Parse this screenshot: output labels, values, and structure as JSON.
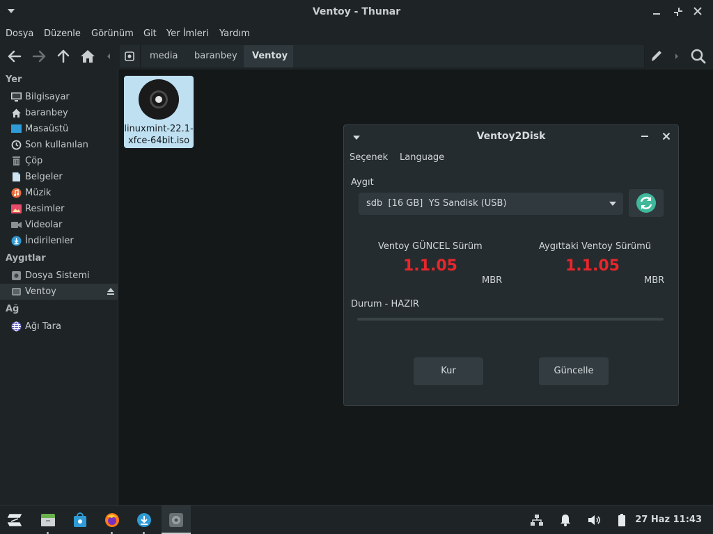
{
  "window": {
    "title": "Ventoy - Thunar"
  },
  "menubar": {
    "items": [
      "Dosya",
      "Düzenle",
      "Görünüm",
      "Git",
      "Yer İmleri",
      "Yardım"
    ]
  },
  "breadcrumb": {
    "items": [
      "media",
      "baranbey",
      "Ventoy"
    ]
  },
  "sidebar": {
    "sections": [
      "Yer",
      "Aygıtlar",
      "Ağ"
    ],
    "places": [
      "Bilgisayar",
      "baranbey",
      "Masaüstü",
      "Son kullanılan",
      "Çöp",
      "Belgeler",
      "Müzik",
      "Resimler",
      "Videolar",
      "İndirilenler"
    ],
    "devices": [
      "Dosya Sistemi",
      "Ventoy"
    ],
    "network": [
      "Ağı Tara"
    ]
  },
  "files": [
    {
      "name": "linuxmint-22.1-xfce-64bit.iso",
      "line1": "linuxmint-22.1-",
      "line2": "xfce-64bit.iso"
    }
  ],
  "dialog": {
    "title": "Ventoy2Disk",
    "menu": [
      "Seçenek",
      "Language"
    ],
    "device_label": "Aygıt",
    "device_value": "sdb  [16 GB]  YS Sandisk (USB)",
    "latest_label": "Ventoy GÜNCEL Sürüm",
    "latest_version": "1.1.05",
    "latest_partition": "MBR",
    "device_version_label": "Aygıttaki Ventoy Sürümü",
    "device_version": "1.1.05",
    "device_partition": "MBR",
    "status": "Durum - HAZIR",
    "progress": 0,
    "install_button": "Kur",
    "update_button": "Güncelle"
  },
  "taskbar": {
    "clock": "27 Haz 11:43"
  },
  "colors": {
    "accent": "#3fb89b",
    "version": "#e8262b",
    "selection": "#bfe0f1"
  }
}
